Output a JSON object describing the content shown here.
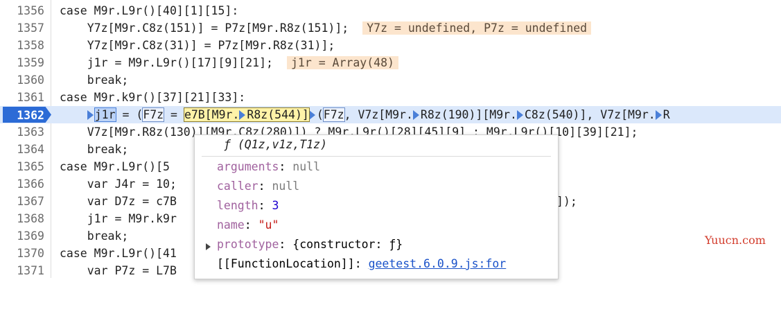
{
  "lines": [
    {
      "num": "1356",
      "code": "case M9r.L9r()[40][1][15]:"
    },
    {
      "num": "1357",
      "code": "    Y7z[M9r.C8z(151)] = P7z[M9r.R8z(151)];",
      "inline": "Y7z = undefined, P7z = undefined"
    },
    {
      "num": "1358",
      "code": "    Y7z[M9r.C8z(31)] = P7z[M9r.R8z(31)];"
    },
    {
      "num": "1359",
      "code": "    j1r = M9r.L9r()[17][9][21];",
      "inline": "j1r = Array(48)"
    },
    {
      "num": "1360",
      "code": "    break;"
    },
    {
      "num": "1361",
      "code": "case M9r.k9r()[37][21][33]:"
    },
    {
      "num": "1362",
      "code": ""
    },
    {
      "num": "1363",
      "code": "    V7z[M9r.R8z(1​30)][M9r.C8z(280)]) ? M9r.L9r()[28][45][9] : M9r.L9r()[10][39][21];"
    },
    {
      "num": "1364",
      "code": "    break;"
    },
    {
      "num": "1365",
      "code": "case M9r.L9r()[5"
    },
    {
      "num": "1366",
      "code": "    var J4r = 10;"
    },
    {
      "num": "1367",
      "code": "    var D7z = c7B",
      "tail": "]);"
    },
    {
      "num": "1368",
      "code": "    j1r = M9r.k9r"
    },
    {
      "num": "1369",
      "code": "    break;"
    },
    {
      "num": "1370",
      "code": "case M9r.L9r()[41"
    },
    {
      "num": "1371",
      "code": "    var P7z = L7B"
    }
  ],
  "current_line": {
    "num": "1362",
    "p1": "j1r",
    "p2": " = (",
    "p3": "F7z",
    "p4": " = ",
    "p5": "e7B[M9r.",
    "p6": "R8z(544)]",
    "p7": "(",
    "p8": "F7z",
    "p9": ", V7z[M9r.",
    "p10": "R8z(190)][M9r.",
    "p11": "C8z(540)], V7z[M9r.",
    "p12": "R"
  },
  "popup": {
    "title": "ƒ (Q1z,v1z,T1z)",
    "arguments_key": "arguments",
    "arguments_val": "null",
    "caller_key": "caller",
    "caller_val": "null",
    "length_key": "length",
    "length_val": "3",
    "name_key": "name",
    "name_val": "\"u\"",
    "prototype_key": "prototype",
    "prototype_val": "{constructor: ƒ}",
    "location_key": "[[FunctionLocation]]",
    "location_val": "geetest.6.0.9.js:for"
  },
  "watermark": "Yuucn.com",
  "colors": {
    "exec_marker": "#2c6bd6",
    "inline_value_bg": "#fce5cd",
    "current_line_bg": "#dbe8fb"
  }
}
